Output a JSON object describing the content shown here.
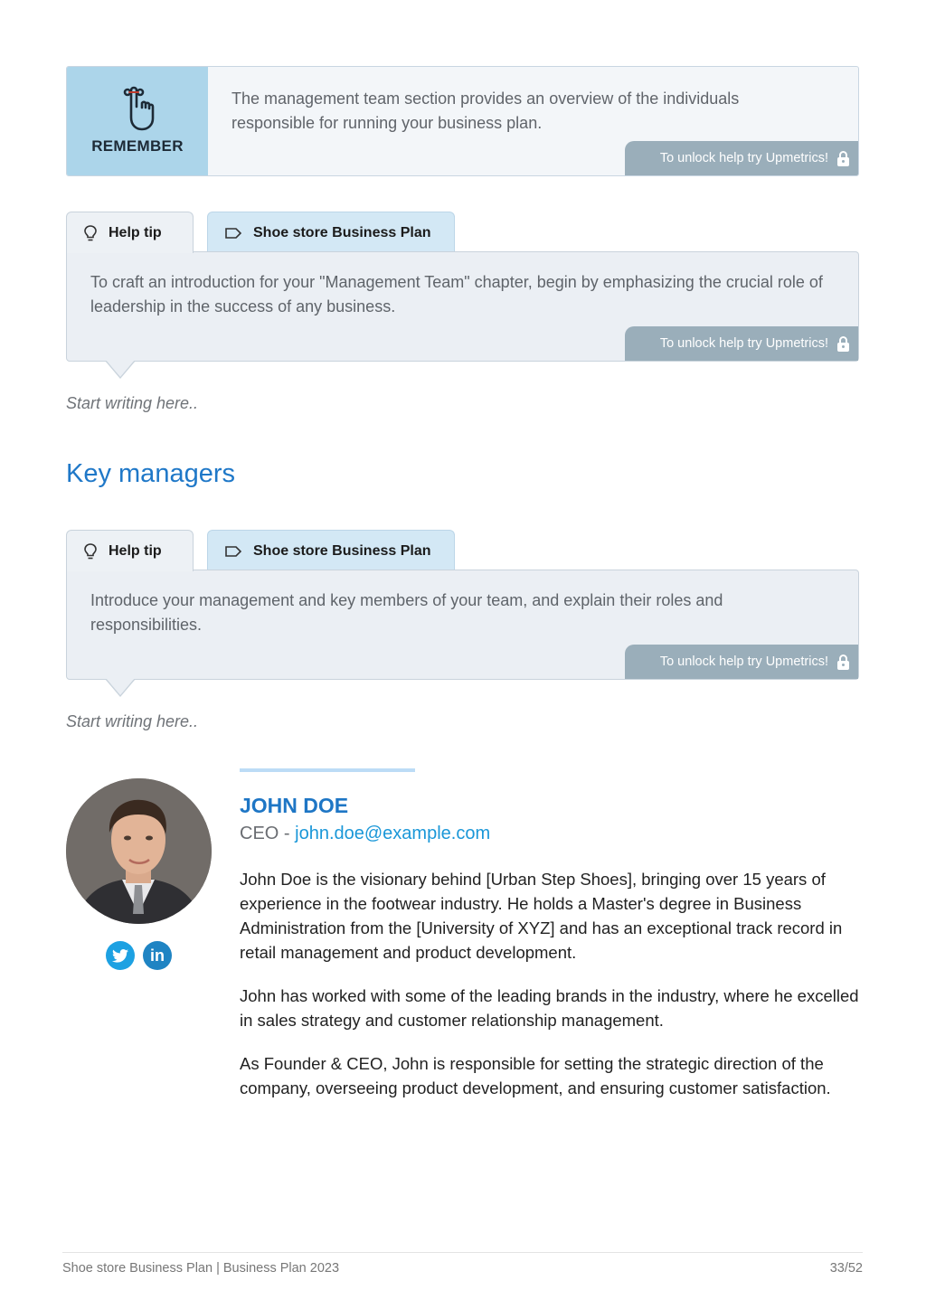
{
  "remember": {
    "label": "REMEMBER",
    "icon": "finger-string-reminder-icon",
    "text": "The management team section provides an overview of the individuals responsible for running your business plan.",
    "unlock_label": "To unlock help try Upmetrics!"
  },
  "help_blocks": [
    {
      "tab_help_label": "Help tip",
      "tab_plan_label": "Shoe store Business Plan",
      "text": "To craft an introduction for your \"Management Team\" chapter, begin by emphasizing the crucial role of leadership in the success of any business.",
      "unlock_label": "To unlock help try Upmetrics!",
      "placeholder": "Start writing here.."
    },
    {
      "tab_help_label": "Help tip",
      "tab_plan_label": "Shoe store Business Plan",
      "text": "Introduce your management and key members of your team, and explain their roles and responsibilities.",
      "unlock_label": "To unlock help try Upmetrics!",
      "placeholder": "Start writing here.."
    }
  ],
  "section": {
    "title": "Key managers"
  },
  "profile": {
    "name": "JOHN DOE",
    "role": "CEO",
    "separator": " - ",
    "email": "john.doe@example.com",
    "bio": [
      "John Doe is the visionary behind [Urban Step Shoes], bringing over 15 years of experience in the footwear industry. He holds a Master's degree in Business Administration from the [University of XYZ] and has an exceptional track record in retail management and product development.",
      "John has worked with some of the leading brands in the industry, where he excelled in sales strategy and customer relationship management.",
      "As Founder & CEO, John is responsible for setting the strategic direction of the company, overseeing product development, and ensuring customer satisfaction."
    ],
    "socials": [
      {
        "name": "twitter",
        "icon": "twitter-icon"
      },
      {
        "name": "linkedin",
        "icon": "linkedin-icon",
        "glyph": "in"
      }
    ]
  },
  "footer": {
    "left": "Shoe store Business Plan | Business Plan 2023",
    "page": "33/52"
  },
  "colors": {
    "accent": "#1f78c8",
    "remember_bg": "#acd5ea",
    "unlock_bg": "#9aaeba",
    "tab_plan_bg": "#d3e8f5",
    "help_bg": "#ebeff4"
  }
}
